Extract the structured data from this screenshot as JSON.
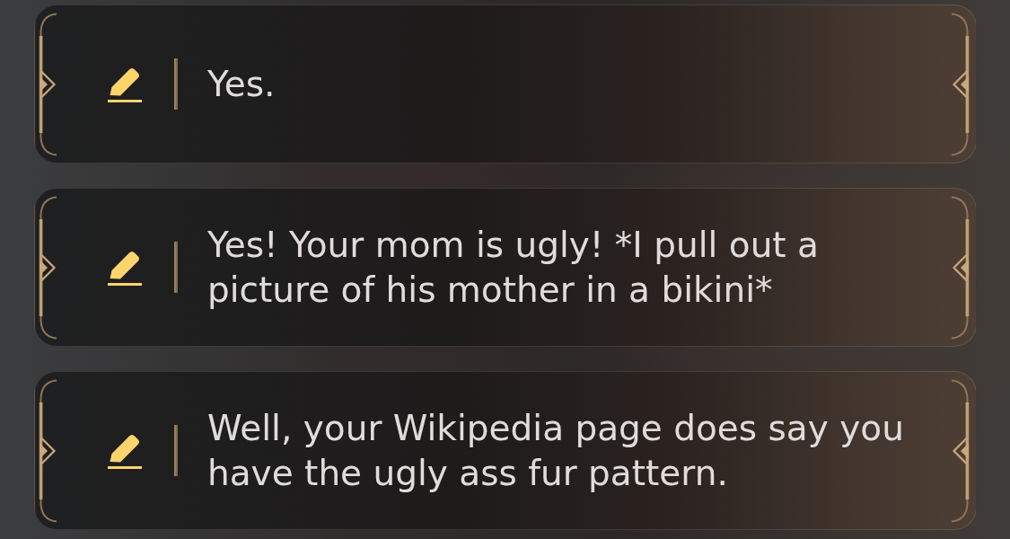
{
  "dialogue_options": [
    {
      "text": "Yes."
    },
    {
      "text": "Yes! Your mom is ugly! *I pull out a picture of his mother in a bikini*"
    },
    {
      "text": "Well, your Wikipedia page does say you have the ugly ass fur pattern."
    }
  ]
}
